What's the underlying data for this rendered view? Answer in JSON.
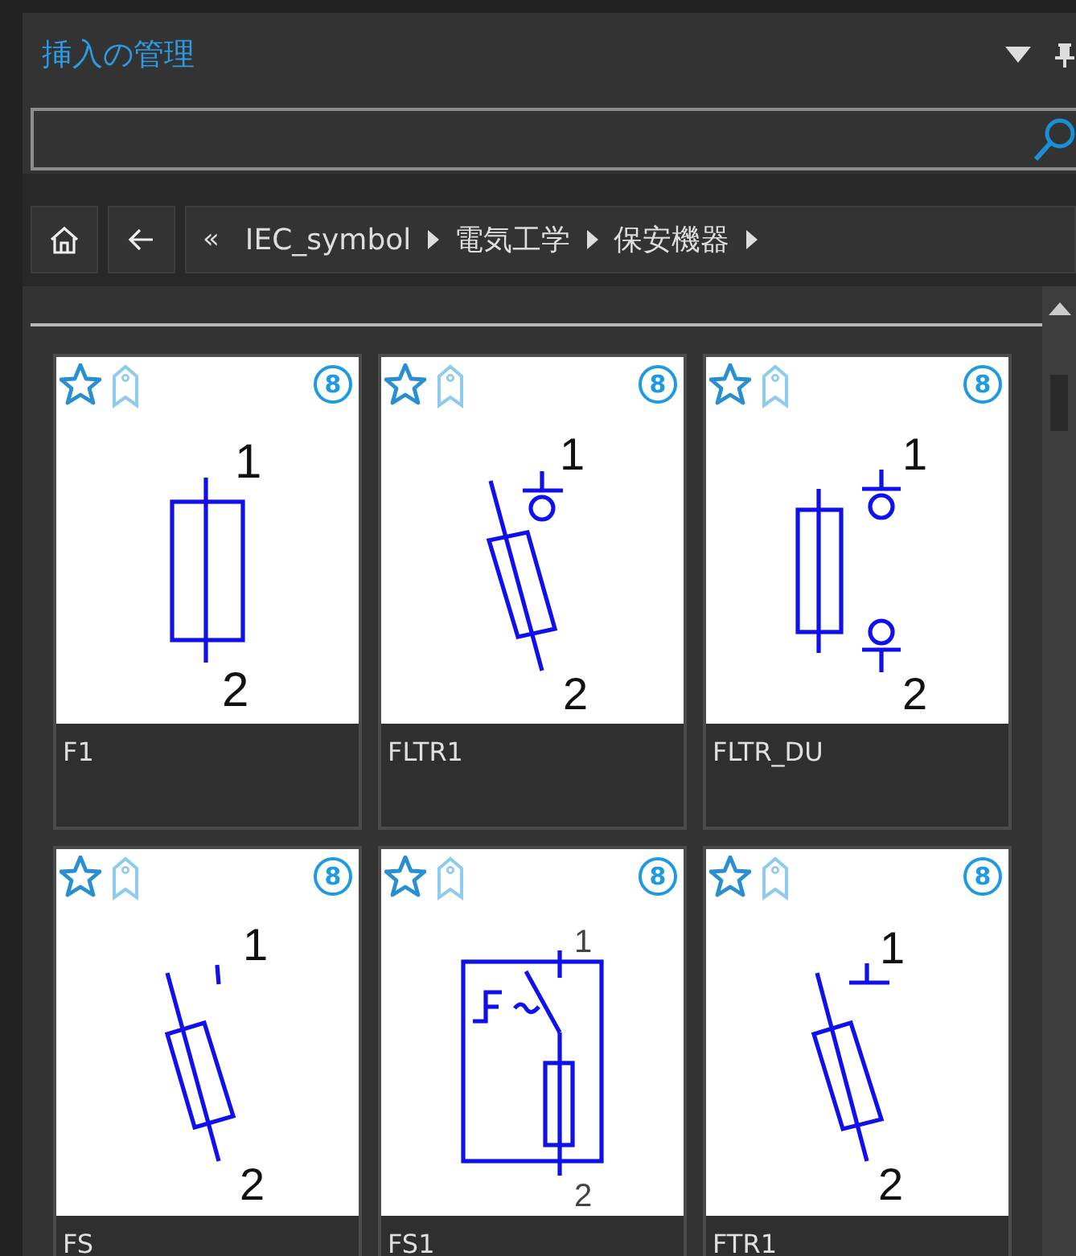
{
  "panel": {
    "title": "挿入の管理"
  },
  "breadcrumb": {
    "overflow": "«",
    "items": [
      "IEC_symbol",
      "電気工学",
      "保安機器"
    ]
  },
  "cards": [
    {
      "name": "F1",
      "kind": "fuse",
      "badge": "8",
      "terminals": [
        "1",
        "2"
      ]
    },
    {
      "name": "FLTR1",
      "kind": "tilted-fuse-ring",
      "badge": "8",
      "terminals": [
        "1",
        "2"
      ]
    },
    {
      "name": "FLTR_DU",
      "kind": "fuse-double-ring",
      "badge": "8",
      "terminals": [
        "1",
        "2"
      ]
    },
    {
      "name": "FS",
      "kind": "tilted-fuse-tick",
      "badge": "8",
      "terminals": [
        "1",
        "2"
      ]
    },
    {
      "name": "FS1",
      "kind": "fuse-switch-box",
      "badge": "8",
      "terminals": [
        "1",
        "2"
      ]
    },
    {
      "name": "FTR1",
      "kind": "tilted-fuse-tee",
      "badge": "8",
      "terminals": [
        "1",
        "2"
      ]
    }
  ]
}
